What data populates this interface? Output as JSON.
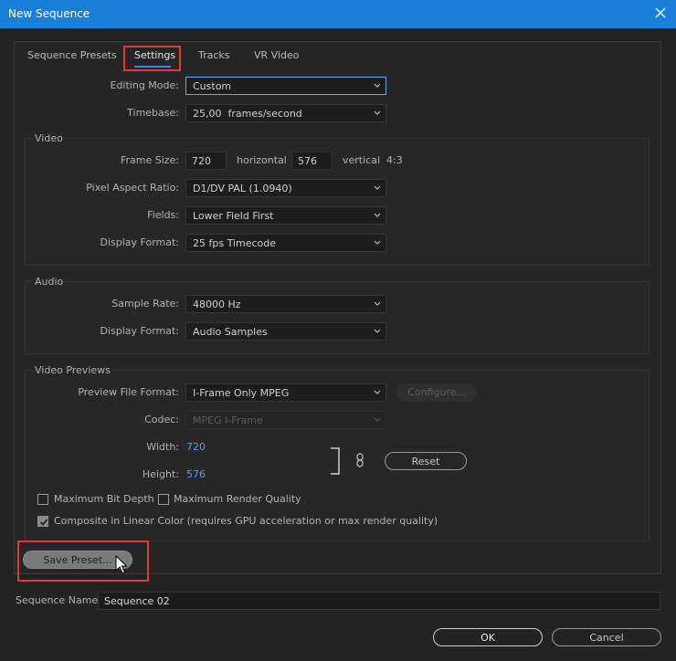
{
  "window": {
    "title": "New Sequence"
  },
  "tabs": [
    {
      "label": "Sequence Presets"
    },
    {
      "label": "Settings"
    },
    {
      "label": "Tracks"
    },
    {
      "label": "VR Video"
    }
  ],
  "general": {
    "editing_mode": {
      "label": "Editing Mode:",
      "value": "Custom"
    },
    "timebase": {
      "label": "Timebase:",
      "value": "25,00  frames/second"
    }
  },
  "video": {
    "title": "Video",
    "frame_size": {
      "label": "Frame Size:",
      "width": "720",
      "horizontal_label": "horizontal",
      "height": "576",
      "vertical_label": "vertical",
      "ratio": "4:3"
    },
    "pixel_aspect": {
      "label": "Pixel Aspect Ratio:",
      "value": "D1/DV PAL (1.0940)"
    },
    "fields": {
      "label": "Fields:",
      "value": "Lower Field First"
    },
    "display_format": {
      "label": "Display Format:",
      "value": "25 fps Timecode"
    }
  },
  "audio": {
    "title": "Audio",
    "sample_rate": {
      "label": "Sample Rate:",
      "value": "48000 Hz"
    },
    "display_format": {
      "label": "Display Format:",
      "value": "Audio Samples"
    }
  },
  "previews": {
    "title": "Video Previews",
    "file_format": {
      "label": "Preview File Format:",
      "value": "I-Frame Only MPEG"
    },
    "configure_label": "Configure...",
    "codec": {
      "label": "Codec:",
      "value": "MPEG I-Frame"
    },
    "width": {
      "label": "Width:",
      "value": "720"
    },
    "height": {
      "label": "Height:",
      "value": "576"
    },
    "reset_label": "Reset",
    "max_bit_depth": {
      "label": "Maximum Bit Depth",
      "checked": false
    },
    "max_render_quality": {
      "label": "Maximum Render Quality",
      "checked": false
    },
    "linear_color": {
      "label": "Composite in Linear Color (requires GPU acceleration or max render quality)",
      "checked": true
    }
  },
  "save_preset_label": "Save Preset...",
  "sequence_name": {
    "label": "Sequence Name:",
    "value": "Sequence 02"
  },
  "buttons": {
    "ok": "OK",
    "cancel": "Cancel"
  },
  "colors": {
    "titlebar": "#1a7fd8",
    "highlight": "#e0393e",
    "accent": "#2d8ceb",
    "value_blue": "#4ea0f0"
  }
}
